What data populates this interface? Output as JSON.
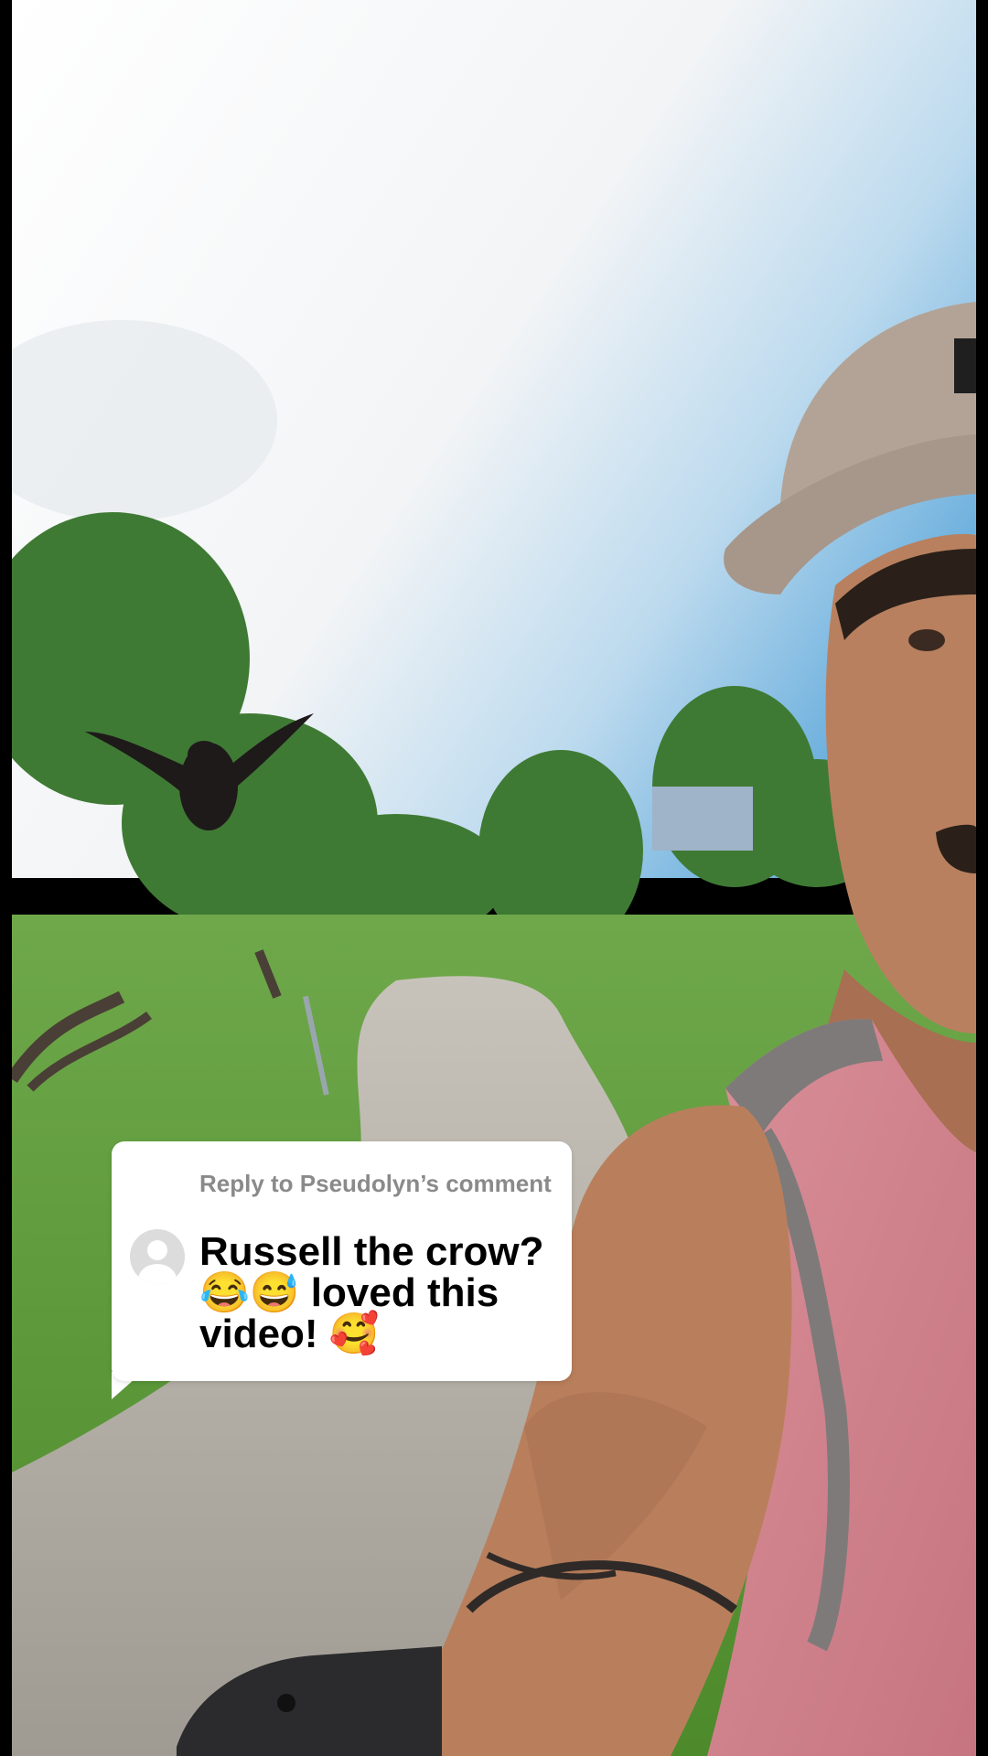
{
  "reply": {
    "header": "Reply to Pseudolyn’s comment",
    "body": "Russell the crow?\n😂😅 loved this video! 🥰"
  },
  "video": {
    "description": ""
  },
  "colors": {
    "sky": "#f3f5f7",
    "sky_blue": "#8ec3e4",
    "grass": "#5c9a3a",
    "road": "#b8b4ab",
    "shirt": "#d48a93",
    "skin": "#b97f5c",
    "cap": "#b6a79b"
  }
}
